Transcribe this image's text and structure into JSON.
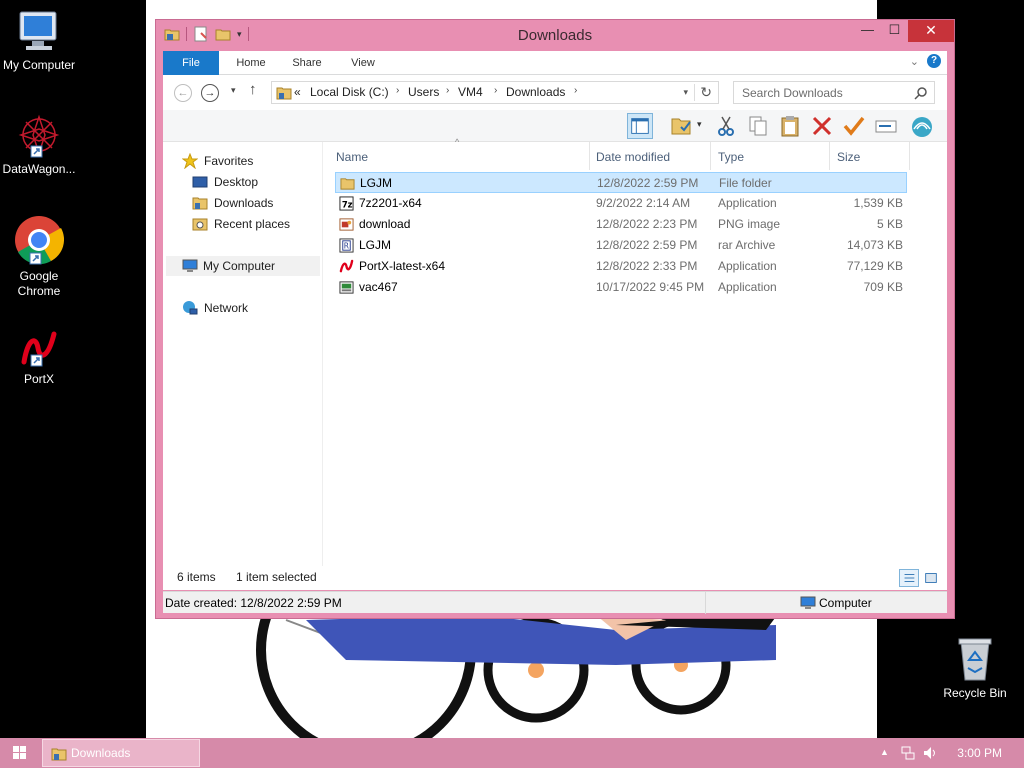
{
  "desktop": {
    "icons": [
      {
        "label": "My Computer"
      },
      {
        "label": "DataWagon..."
      },
      {
        "label": "Google Chrome"
      },
      {
        "label": "PortX"
      },
      {
        "label": "Recycle Bin"
      }
    ]
  },
  "window": {
    "title": "Downloads",
    "buttons": {
      "minimize": "—",
      "maximize": "☐",
      "close": "✕"
    },
    "ribbon_tabs": [
      "File",
      "Home",
      "Share",
      "View"
    ],
    "address": {
      "prefix": "«",
      "crumbs": [
        "Local Disk (C:)",
        "Users",
        "VM4",
        "Downloads"
      ]
    },
    "search_placeholder": "Search Downloads",
    "nav_pane": {
      "favorites": "Favorites",
      "favorite_items": [
        "Desktop",
        "Downloads",
        "Recent places"
      ],
      "computer": "My Computer",
      "network": "Network"
    },
    "columns": {
      "name": "Name",
      "date": "Date modified",
      "type": "Type",
      "size": "Size"
    },
    "files": [
      {
        "name": "LGJM",
        "date": "12/8/2022 2:59 PM",
        "type": "File folder",
        "size": "",
        "icon": "folder-icon",
        "selected": true
      },
      {
        "name": "7z2201-x64",
        "date": "9/2/2022 2:14 AM",
        "type": "Application",
        "size": "1,539 KB",
        "icon": "7zip-icon",
        "selected": false
      },
      {
        "name": "download",
        "date": "12/8/2022 2:23 PM",
        "type": "PNG image",
        "size": "5 KB",
        "icon": "image-icon",
        "selected": false
      },
      {
        "name": "LGJM",
        "date": "12/8/2022 2:59 PM",
        "type": "rar Archive",
        "size": "14,073 KB",
        "icon": "rar-icon",
        "selected": false
      },
      {
        "name": "PortX-latest-x64",
        "date": "12/8/2022 2:33 PM",
        "type": "Application",
        "size": "77,129 KB",
        "icon": "portx-icon",
        "selected": false
      },
      {
        "name": "vac467",
        "date": "10/17/2022 9:45 PM",
        "type": "Application",
        "size": "709 KB",
        "icon": "installer-icon",
        "selected": false
      }
    ],
    "item_count": "6 items",
    "selection_count": "1 item selected",
    "status_left": "Date created: 12/8/2022 2:59 PM",
    "status_right": "Computer"
  },
  "taskbar": {
    "task_label": "Downloads",
    "clock": "3:00 PM"
  },
  "colors": {
    "window_frame": "#e88fb2",
    "taskbar": "#d68aa9",
    "file_tab": "#1979ca",
    "selection": "#cce8ff"
  }
}
